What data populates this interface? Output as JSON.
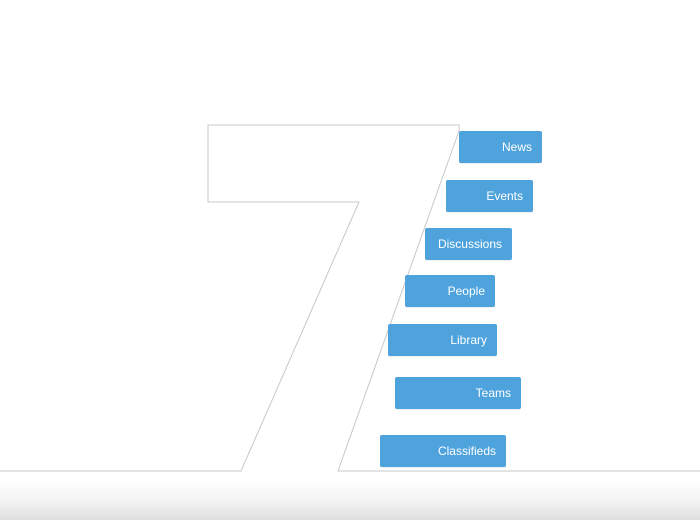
{
  "diagram": {
    "items": [
      {
        "label": "News"
      },
      {
        "label": "Events"
      },
      {
        "label": "Discussions"
      },
      {
        "label": "People"
      },
      {
        "label": "Library"
      },
      {
        "label": "Teams"
      },
      {
        "label": "Classifieds"
      }
    ]
  },
  "colors": {
    "tag_background": "#4fa3dd",
    "tag_text": "#ffffff",
    "outline": "#c8c8c8",
    "background": "#ffffff"
  }
}
